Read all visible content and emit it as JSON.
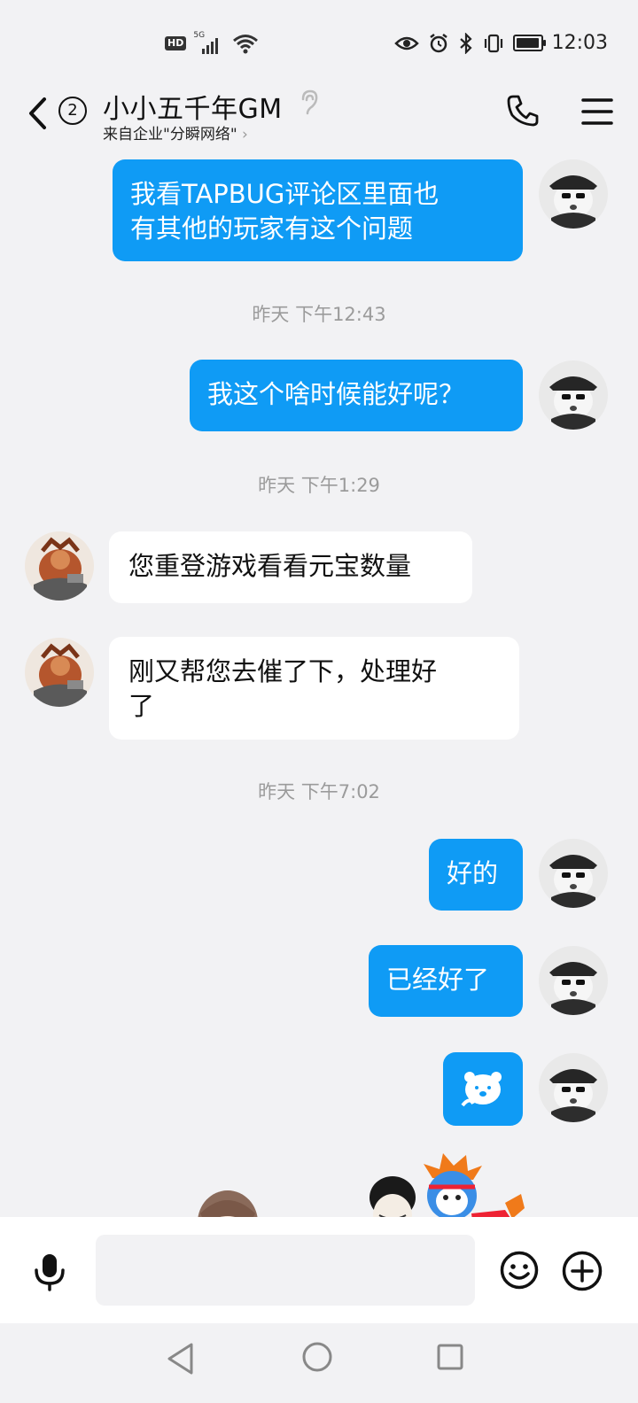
{
  "status_bar": {
    "hd": "HD",
    "network": "5G",
    "time": "12:03"
  },
  "header": {
    "badge_count": "2",
    "title": "小小五千年GM",
    "subtitle": "来自企业\"分瞬网络\"",
    "subtitle_chevron": "›"
  },
  "messages": [
    {
      "side": "out",
      "lines": [
        "我看TAPBUG评论区里面也",
        "有其他的玩家有这个问题"
      ]
    },
    {
      "timestamp": "昨天 下午12:43"
    },
    {
      "side": "out",
      "lines": [
        "我这个啥时候能好呢？"
      ]
    },
    {
      "timestamp": "昨天 下午1:29"
    },
    {
      "side": "in",
      "lines": [
        "您重登游戏看看元宝数量"
      ]
    },
    {
      "side": "in",
      "lines": [
        "刚又帮您去催了下，处理好",
        "了"
      ]
    },
    {
      "timestamp": "昨天 下午7:02"
    },
    {
      "side": "out",
      "lines": [
        "好的"
      ]
    },
    {
      "side": "out",
      "lines": [
        "已经好了"
      ]
    },
    {
      "side": "out",
      "sticker": "bear-sticker-icon"
    }
  ],
  "colors": {
    "outgoing_bubble": "#0f9bf5",
    "incoming_bubble": "#ffffff",
    "background": "#f2f2f4"
  },
  "icons": {
    "back": "chevron-left-icon",
    "ear": "ear-icon",
    "phone": "phone-icon",
    "menu": "menu-icon",
    "mic": "microphone-icon",
    "emoji": "emoji-icon",
    "plus": "plus-circle-icon"
  }
}
